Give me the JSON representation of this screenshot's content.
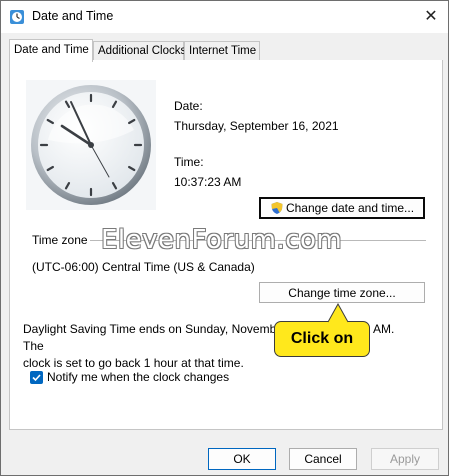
{
  "window": {
    "title": "Date and Time",
    "close_glyph": "✕"
  },
  "tabs": [
    {
      "label": "Date and Time",
      "active": true
    },
    {
      "label": "Additional Clocks",
      "active": false
    },
    {
      "label": "Internet Time",
      "active": false
    }
  ],
  "datetime": {
    "date_label": "Date:",
    "date_value": "Thursday, September 16, 2021",
    "time_label": "Time:",
    "time_value": "10:37:23 AM",
    "change_button": "Change date and time..."
  },
  "timezone": {
    "section_label": "Time zone",
    "value": "(UTC-06:00) Central Time (US & Canada)",
    "change_button": "Change time zone..."
  },
  "watermark": "ElevenForum.com",
  "dst": {
    "line1": "Daylight Saving Time ends on Sunday, November 7, 2021 at 2:00 AM. The",
    "line2": "clock is set to go back 1 hour at that time."
  },
  "notify": {
    "label": "Notify me when the clock changes",
    "checked": true
  },
  "callout": {
    "label": "Click on",
    "color": "#ffe81c"
  },
  "footer": {
    "ok": "OK",
    "cancel": "Cancel",
    "apply": "Apply"
  },
  "colors": {
    "accent": "#0067c0",
    "titlebar": "#ffffff",
    "dialog_bg": "#f0f0f0"
  }
}
